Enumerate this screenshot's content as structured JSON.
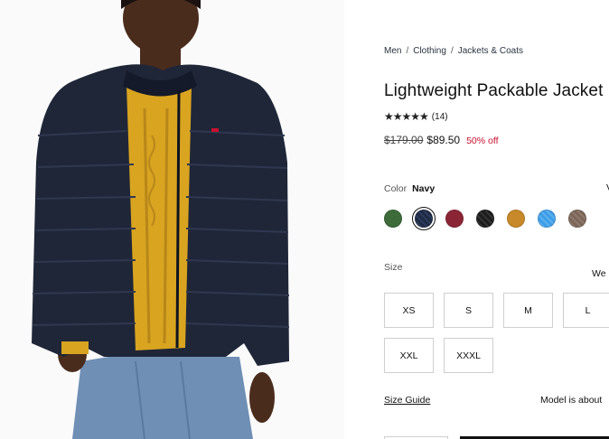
{
  "breadcrumb": [
    "Men",
    "Clothing",
    "Jackets & Coats"
  ],
  "product": {
    "title": "Lightweight Packable Jacket",
    "rating_stars": "★★★★★",
    "review_count": "(14)",
    "rating_value": 5,
    "original_price": "$179.00",
    "sale_price": "$89.50",
    "discount": "50% off"
  },
  "color": {
    "label": "Color",
    "selected": "Navy",
    "view_link": "V",
    "swatches": [
      {
        "name": "green-swatch",
        "hex": "#3d6b3a"
      },
      {
        "name": "navy-swatch",
        "hex": "#1f2a44",
        "selected": true
      },
      {
        "name": "burgundy-swatch",
        "hex": "#8b2535"
      },
      {
        "name": "black-swatch",
        "hex": "#1c1c1c"
      },
      {
        "name": "mustard-swatch",
        "hex": "#c8892a"
      },
      {
        "name": "blue-swatch",
        "hex": "#3d9ce6"
      },
      {
        "name": "brown-swatch",
        "hex": "#7a6558"
      }
    ]
  },
  "size": {
    "label": "Size",
    "aside": "We",
    "options": [
      "XS",
      "S",
      "M",
      "L",
      "XXL",
      "XXXL"
    ]
  },
  "size_guide": "Size Guide",
  "model_info": "Model is about",
  "colors": {
    "sale_red": "#c8102e",
    "text": "#111111"
  }
}
